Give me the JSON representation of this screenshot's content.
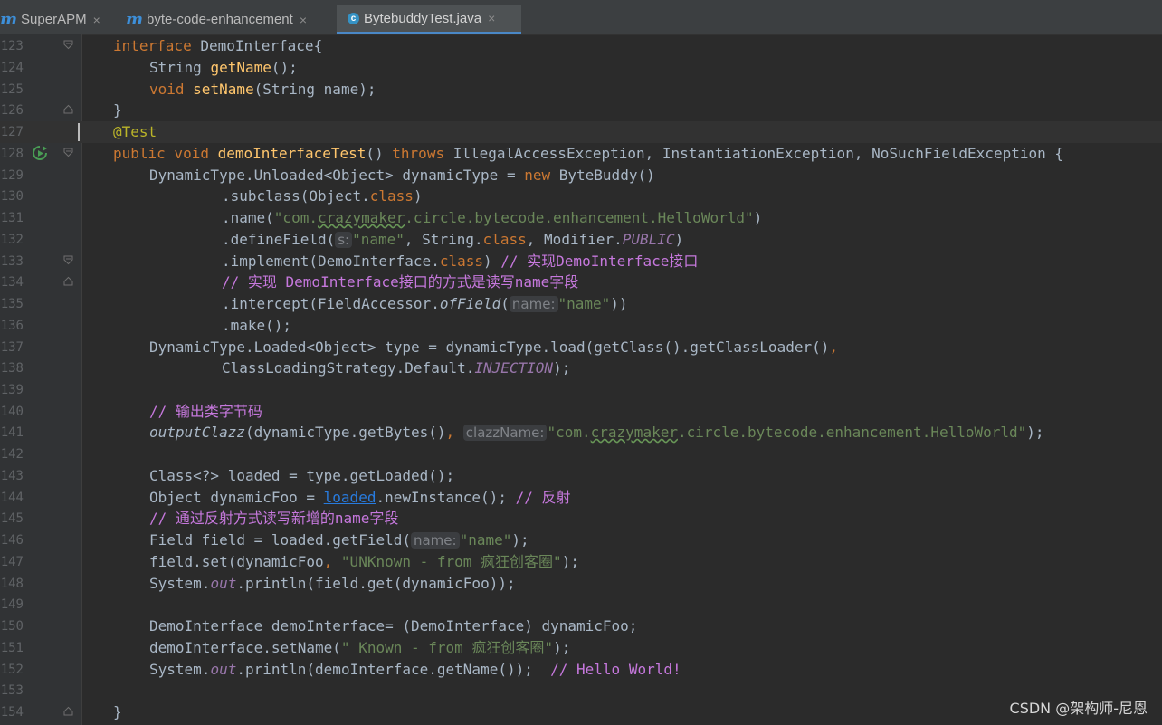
{
  "tabs": [
    {
      "icon": "m",
      "label": "SuperAPM",
      "close": "×"
    },
    {
      "icon": "m",
      "label": "byte-code-enhancement",
      "close": "×"
    },
    {
      "icon": "c",
      "label": "BytebuddyTest.java",
      "close": "×"
    }
  ],
  "lines": [
    {
      "n": "123"
    },
    {
      "n": "124"
    },
    {
      "n": "125"
    },
    {
      "n": "126"
    },
    {
      "n": "127"
    },
    {
      "n": "128"
    },
    {
      "n": "129"
    },
    {
      "n": "130"
    },
    {
      "n": "131"
    },
    {
      "n": "132"
    },
    {
      "n": "133"
    },
    {
      "n": "134"
    },
    {
      "n": "135"
    },
    {
      "n": "136"
    },
    {
      "n": "137"
    },
    {
      "n": "138"
    },
    {
      "n": "139"
    },
    {
      "n": "140"
    },
    {
      "n": "141"
    },
    {
      "n": "142"
    },
    {
      "n": "143"
    },
    {
      "n": "144"
    },
    {
      "n": "145"
    },
    {
      "n": "146"
    },
    {
      "n": "147"
    },
    {
      "n": "148"
    },
    {
      "n": "149"
    },
    {
      "n": "150"
    },
    {
      "n": "151"
    },
    {
      "n": "152"
    },
    {
      "n": "153"
    },
    {
      "n": "154"
    }
  ],
  "code": {
    "l123": [
      "interface",
      " DemoInterface{"
    ],
    "l124": [
      "String ",
      "getName",
      "();"
    ],
    "l125": [
      "void",
      " ",
      "setName",
      "(String name);"
    ],
    "l126": [
      "}"
    ],
    "l127": [
      "@Test"
    ],
    "l128": [
      "public void",
      " ",
      "demoInterfaceTest",
      "() ",
      "throws",
      " IllegalAccessException, InstantiationException, NoSuchFieldException {"
    ],
    "l129": [
      "DynamicType.Unloaded<Object> dynamicType = ",
      "new",
      " ByteBuddy()"
    ],
    "l130": [
      ".subclass(Object.",
      "class",
      ")"
    ],
    "l131": [
      ".name(",
      "\"com.",
      "crazymaker",
      ".circle.bytecode.enhancement.HelloWorld\"",
      ")"
    ],
    "l132": [
      ".defineField(",
      "s:",
      "\"name\"",
      ", String.",
      "class",
      ", Modifier.",
      "PUBLIC",
      ")"
    ],
    "l133": [
      ".implement(DemoInterface.",
      "class",
      ") ",
      "// 实现DemoInterface接口"
    ],
    "l134": [
      "// 实现 DemoInterface接口的方式是读写name字段"
    ],
    "l135": [
      ".intercept(FieldAccessor.",
      "ofField",
      "(",
      "name:",
      "\"name\"",
      "))"
    ],
    "l136": [
      ".make();"
    ],
    "l137": [
      "DynamicType.Loaded<Object> type = dynamicType.load(getClass().getClassLoader()",
      ","
    ],
    "l138": [
      "ClassLoadingStrategy.Default.",
      "INJECTION",
      ");"
    ],
    "l140": [
      "// 输出类字节码"
    ],
    "l141": [
      "outputClazz",
      "(dynamicType.getBytes()",
      ", ",
      "clazzName:",
      "\"com.",
      "crazymaker",
      ".circle.bytecode.enhancement.HelloWorld\"",
      ");"
    ],
    "l143": [
      "Class<?> loaded = type.getLoaded();"
    ],
    "l144": [
      "Object dynamicFoo = ",
      "loaded",
      ".newInstance(); ",
      "// 反射"
    ],
    "l145": [
      "// 通过反射方式读写新增的name字段"
    ],
    "l146": [
      "Field field = loaded.getField(",
      "name:",
      "\"name\"",
      ");"
    ],
    "l147": [
      "field.set(dynamicFoo",
      ", ",
      "\"UNKnown - from 疯狂创客圈\"",
      ");"
    ],
    "l148": [
      "System.",
      "out",
      ".println(field.get(dynamicFoo));"
    ],
    "l150": [
      "DemoInterface demoInterface= (DemoInterface) dynamicFoo;"
    ],
    "l151": [
      "demoInterface.setName(",
      "\" Known - from 疯狂创客圈\"",
      ");"
    ],
    "l152": [
      "System.",
      "out",
      ".println(demoInterface.getName());  ",
      "// Hello World!"
    ],
    "l154": [
      "}"
    ]
  },
  "colors": {
    "background": "#2b2b2b",
    "keyword": "#cc7832",
    "method": "#ffc66d",
    "string": "#6a8759",
    "comment": "#c678dd",
    "static": "#9876aa",
    "annotation": "#bbb529",
    "link": "#287bde"
  },
  "watermark": "CSDN @架构师-尼恩"
}
